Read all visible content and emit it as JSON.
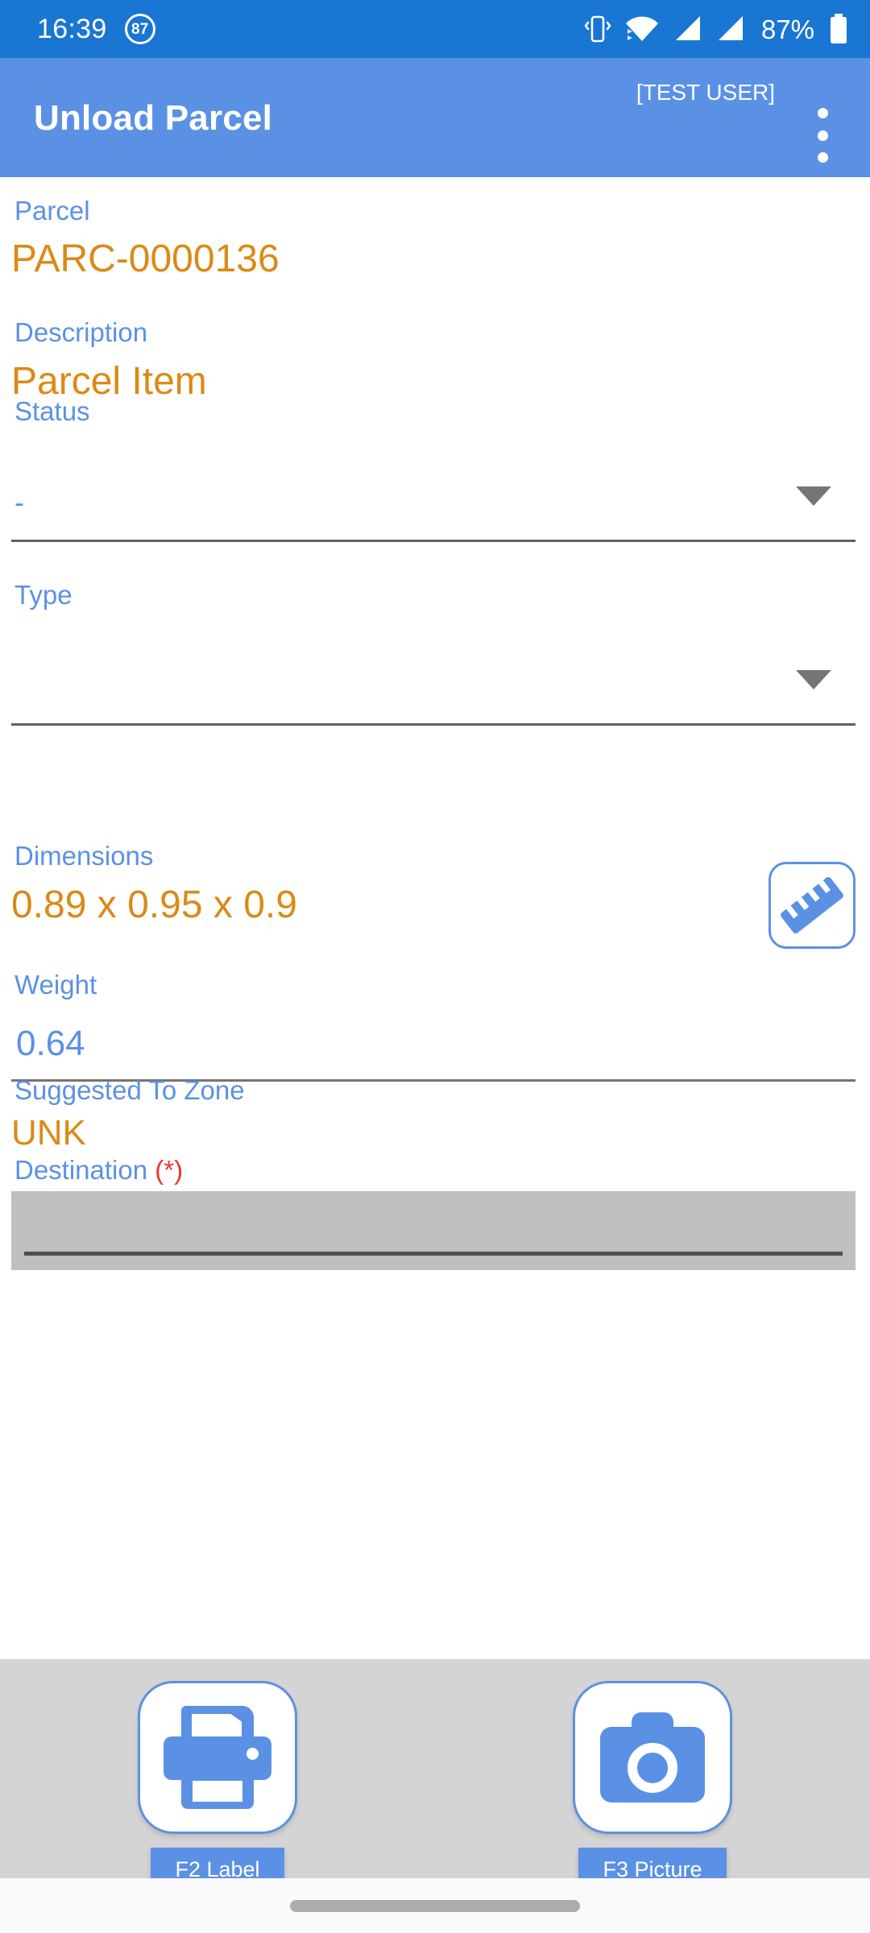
{
  "status_bar": {
    "time": "16:39",
    "badge": "87",
    "battery_percent": "87%",
    "icons": [
      "vibrate-icon",
      "wifi-icon",
      "signal-icon",
      "signal-icon",
      "battery-icon"
    ]
  },
  "app_bar": {
    "title": "Unload Parcel",
    "user": "[TEST USER]",
    "overflow_menu": "overflow-menu-icon"
  },
  "form": {
    "parcel": {
      "label": "Parcel",
      "value": "PARC-0000136"
    },
    "description": {
      "label": "Description",
      "value": "Parcel Item"
    },
    "status": {
      "label": "Status",
      "value": "-"
    },
    "type": {
      "label": "Type",
      "value": ""
    },
    "dimensions": {
      "label": "Dimensions",
      "value": "0.89 x 0.95 x 0.9",
      "measure_icon": "ruler-icon"
    },
    "weight": {
      "label": "Weight",
      "value": "0.64"
    },
    "suggested_to_zone": {
      "label": "Suggested To Zone",
      "value": "UNK"
    },
    "destination": {
      "label": "Destination",
      "required_marker": "(*)",
      "value": ""
    }
  },
  "actions": [
    {
      "icon": "printer-icon",
      "label": "F2 Label"
    },
    {
      "icon": "camera-icon",
      "label": "F3 Picture"
    }
  ],
  "colors": {
    "status_bar": "#1976D2",
    "app_bar": "#5B91E4",
    "label_blue": "#5B91E4",
    "value_orange": "#DB8A16",
    "required_red": "#E53935",
    "action_bar_gray": "#D4D4D4",
    "disabled_field_gray": "#BFBFBF"
  }
}
